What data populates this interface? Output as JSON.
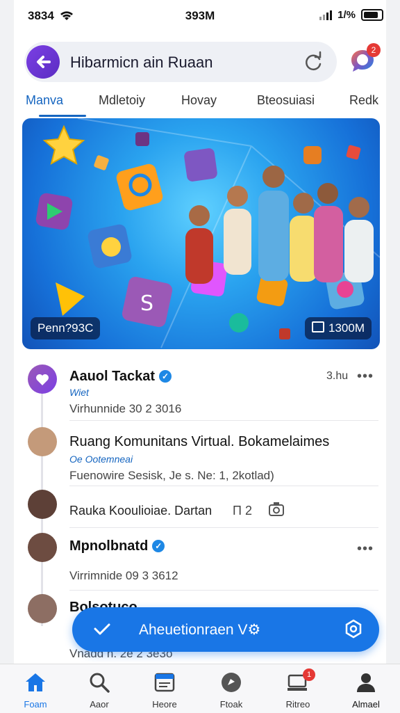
{
  "status_bar": {
    "time": "3834",
    "center": "393M",
    "battery": "1/%"
  },
  "header": {
    "title": "Hibarmicn ain Ruaan",
    "chat_badge": "2"
  },
  "tabs": [
    {
      "label": "Manva",
      "active": true
    },
    {
      "label": "Mdletoiy",
      "active": false
    },
    {
      "label": "Hovay",
      "active": false
    },
    {
      "label": "Bteosuiasi",
      "active": false
    },
    {
      "label": "Redk",
      "active": false
    }
  ],
  "banner": {
    "left_chip": "Penn?93C",
    "right_chip": "1300M"
  },
  "posts": [
    {
      "name": "Aauol Tackat",
      "tag": "Wiet",
      "meta": "Virhunnide 30 2 3016",
      "time": "3.hu"
    },
    {
      "name": "Ruang Komunitans Virtual. Bokamelaimes",
      "tag": "Oe Ootemneai",
      "meta": "Fuenowire Sesisk, Je s. Ne: 1, 2kotlad)"
    },
    {
      "meta": "Rauka Kooulioiae. Dartan",
      "counter": "П 2"
    },
    {
      "name": "Mpnolbnatd",
      "tag": "",
      "meta": "Virrimnide 09 3 3612"
    },
    {
      "name": "Bolsotuco",
      "meta": "Vnadd n. 2e 2 3e3o"
    }
  ],
  "fab": {
    "label": "Aheuetionraen V"
  },
  "bottom_nav": [
    {
      "label": "Foam",
      "icon": "home-icon",
      "active": true
    },
    {
      "label": "Aaor",
      "icon": "search-icon",
      "active": false
    },
    {
      "label": "Heore",
      "icon": "calendar-icon",
      "active": false
    },
    {
      "label": "Ftoak",
      "icon": "discover-icon",
      "active": false
    },
    {
      "label": "Ritreo",
      "icon": "inbox-icon",
      "active": false,
      "badge": "1"
    },
    {
      "label": "Almael",
      "icon": "profile-icon",
      "active": false
    }
  ],
  "colors": {
    "accent": "#1976e6",
    "brand_purple": "#7b3fe4",
    "badge_red": "#e53935"
  }
}
